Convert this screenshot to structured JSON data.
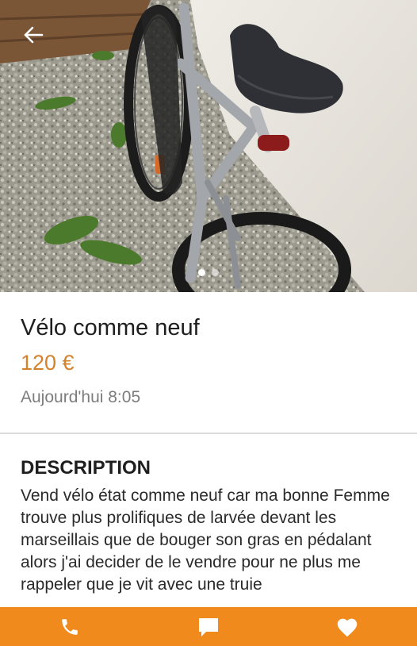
{
  "listing": {
    "title": "Vélo comme neuf",
    "price": "120 €",
    "date": "Aujourd'hui 8:05"
  },
  "description": {
    "heading": "DESCRIPTION",
    "text": "Vend vélo état comme neuf car ma bonne Femme trouve plus prolifiques de larvée devant les marseillais que de bouger son gras en pédalant alors j'ai decider de le vendre pour ne plus me rappeler que je vit avec une truie"
  },
  "gallery": {
    "image_count": 2,
    "active_index": 1
  },
  "icons": {
    "back": "arrow-left-icon",
    "call": "phone-icon",
    "message": "chat-bubble-icon",
    "favorite": "heart-icon"
  },
  "colors": {
    "accent": "#f08a1c",
    "price": "#d4822c"
  }
}
